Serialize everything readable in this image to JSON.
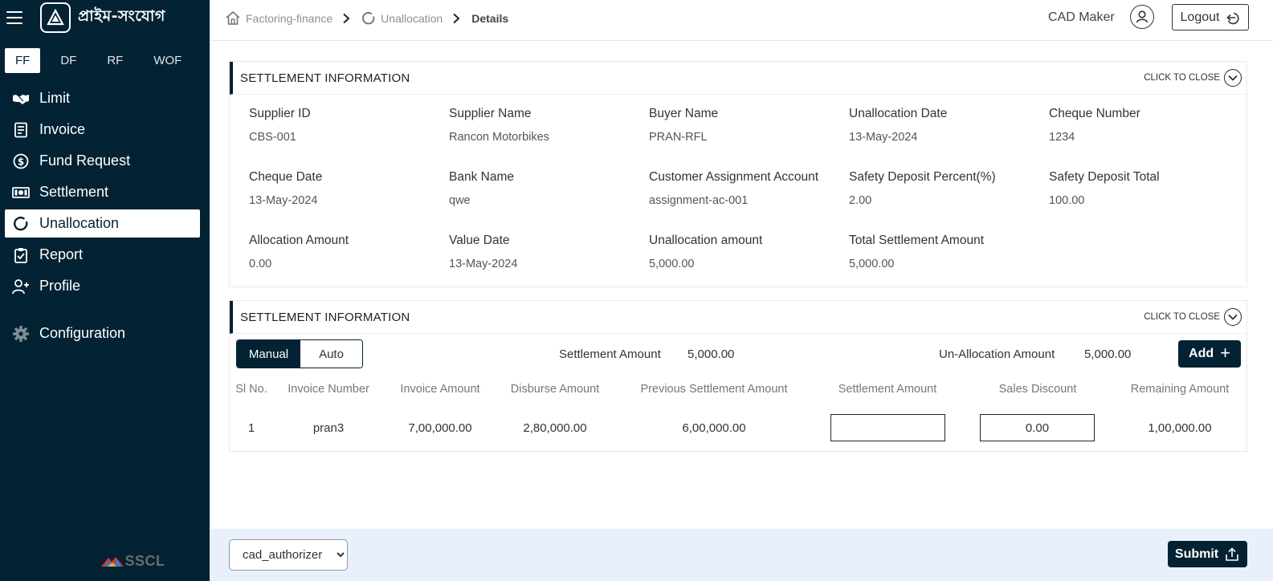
{
  "brand": {
    "name": "প্রাইম-সংযোগ"
  },
  "finance_tabs": [
    "FF",
    "DF",
    "RF",
    "WOF"
  ],
  "sidebar": {
    "items": [
      {
        "label": "Limit",
        "icon": "handshake-icon"
      },
      {
        "label": "Invoice",
        "icon": "invoice-icon"
      },
      {
        "label": "Fund Request",
        "icon": "dollar-circle-icon"
      },
      {
        "label": "Settlement",
        "icon": "cash-icon"
      },
      {
        "label": "Unallocation",
        "icon": "circle-notch-icon"
      },
      {
        "label": "Report",
        "icon": "clipboard-icon"
      },
      {
        "label": "Profile",
        "icon": "user-plus-icon"
      },
      {
        "label": "Configuration",
        "icon": "gear-icon"
      }
    ],
    "powered_by": "Powered By",
    "powered_brand": "SSCL"
  },
  "breadcrumb": {
    "items": [
      "Factoring-finance",
      "Unallocation",
      "Details"
    ]
  },
  "header": {
    "user_name": "CAD Maker",
    "logout_label": "Logout"
  },
  "section1": {
    "title": "SETTLEMENT INFORMATION",
    "close_label": "CLICK TO CLOSE",
    "fields": [
      {
        "label": "Supplier ID",
        "value": "CBS-001"
      },
      {
        "label": "Supplier Name",
        "value": "Rancon Motorbikes"
      },
      {
        "label": "Buyer Name",
        "value": "PRAN-RFL"
      },
      {
        "label": "Unallocation Date",
        "value": "13-May-2024"
      },
      {
        "label": "Cheque Number",
        "value": "1234"
      },
      {
        "label": "Cheque Date",
        "value": "13-May-2024"
      },
      {
        "label": "Bank Name",
        "value": "qwe"
      },
      {
        "label": "Customer Assignment Account",
        "value": "assignment-ac-001"
      },
      {
        "label": "Safety Deposit Percent(%)",
        "value": "2.00"
      },
      {
        "label": "Safety Deposit Total",
        "value": "100.00"
      },
      {
        "label": "Allocation Amount",
        "value": "0.00"
      },
      {
        "label": "Value Date",
        "value": "13-May-2024"
      },
      {
        "label": "Unallocation amount",
        "value": "5,000.00"
      },
      {
        "label": "Total Settlement Amount",
        "value": "5,000.00"
      }
    ]
  },
  "section2": {
    "title": "SETTLEMENT INFORMATION",
    "close_label": "CLICK TO CLOSE",
    "mode_manual": "Manual",
    "mode_auto": "Auto",
    "settlement_amount_label": "Settlement Amount",
    "settlement_amount_value": "5,000.00",
    "unallocation_amount_label": "Un-Allocation Amount",
    "unallocation_amount_value": "5,000.00",
    "add_label": "Add",
    "columns": [
      "Sl No.",
      "Invoice Number",
      "Invoice Amount",
      "Disburse Amount",
      "Previous Settlement Amount",
      "Settlement Amount",
      "Sales Discount",
      "Remaining Amount"
    ],
    "rows": [
      {
        "sl": "1",
        "invoice_number": "pran3",
        "invoice_amount": "7,00,000.00",
        "disburse_amount": "2,80,000.00",
        "previous_settlement": "6,00,000.00",
        "settlement_amount": "",
        "sales_discount": "0.00",
        "remaining_amount": "1,00,000.00"
      }
    ]
  },
  "footer": {
    "role_selected": "cad_authorizer",
    "submit_label": "Submit"
  },
  "colors": {
    "primary": "#032233",
    "footer_bg": "#e8f1fb"
  }
}
